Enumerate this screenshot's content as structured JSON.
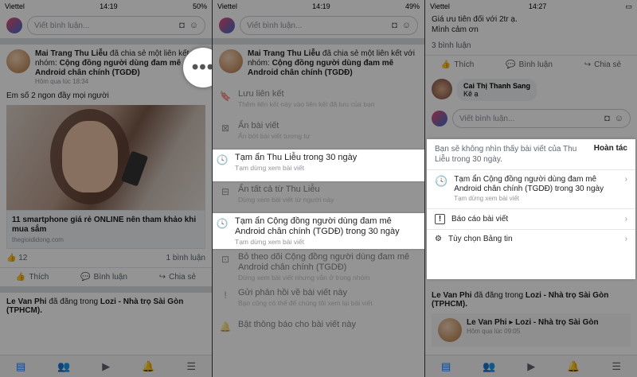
{
  "status": {
    "carrier": "Viettel",
    "time1": "14:19",
    "time2": "14:19",
    "time3": "14:27",
    "battery": "50%",
    "battery2": "49%"
  },
  "composer": {
    "placeholder": "Viết bình luận..."
  },
  "post": {
    "author": "Mai Trang Thu Liễu",
    "action": "đã chia sẻ một liên kết với nhóm:",
    "group": "Cộng đồng người dùng đam mê Android chân chính (TGDĐ)",
    "time": "Hôm qua lúc 18:34",
    "text": "Em số 2 ngon đầy mọi người",
    "link_title": "11 smartphone giá rẻ ONLINE nên tham khảo khi mua sắm",
    "link_domain": "thegioididong.com",
    "reactions_count": "12",
    "comments_count": "1 bình luận",
    "like": "Thích",
    "comment": "Bình luận",
    "share": "Chia sẻ"
  },
  "next_post": {
    "author": "Le Van Phi",
    "action": "đã đăng trong",
    "group": "Lozi - Nhà trọ Sài Gòn (TPHCM)."
  },
  "menu": [
    {
      "label": "Lưu liên kết",
      "desc": "Thêm liên kết này vào liên kết đã lưu của bạn",
      "icon": "bookmark-icon"
    },
    {
      "label": "Ẩn bài viết",
      "desc": "Ẩn bớt bài viết tương tự",
      "icon": "hide-icon"
    },
    {
      "label": "Tạm ẩn Thu Liễu trong 30 ngày",
      "desc": "Tạm dừng xem bài viết",
      "icon": "clock-icon"
    },
    {
      "label": "Ẩn tất cả từ Thu Liễu",
      "desc": "Dừng xem bài viết từ người này",
      "icon": "hide-all-icon"
    },
    {
      "label": "Tạm ẩn Cộng đồng người dùng đam mê Android chân chính (TGDĐ) trong 30 ngày",
      "desc": "Tạm dừng xem bài viết",
      "icon": "clock-icon"
    },
    {
      "label": "Bỏ theo dõi Cộng đồng người dùng đam mê Android chân chính (TGDĐ)",
      "desc": "Dừng xem bài viết nhưng vẫn ở trong nhóm",
      "icon": "unfollow-icon"
    },
    {
      "label": "Gửi phản hồi về bài viết này",
      "desc": "Bạn cũng có thể để chúng tôi xem lại bài viết",
      "icon": "feedback-icon"
    },
    {
      "label": "Bật thông báo cho bài viết này",
      "desc": "",
      "icon": "bell-icon"
    }
  ],
  "panel3": {
    "top_text1": "Giá ưu tiên đối với 2tr ạ.",
    "top_text2": "Mình cảm ơn",
    "comments_count": "3 bình luận",
    "commenter": "Cai Thị Thanh Sang",
    "comment_text": "Kê ạ",
    "card": {
      "notice": "Bạn sẽ không nhìn thấy bài viết của Thu Liễu trong 30 ngày.",
      "undo": "Hoàn tác",
      "snooze_label": "Tạm ẩn Cộng đồng người dùng đam mê Android chân chính (TGDĐ) trong 30 ngày",
      "snooze_desc": "Tạm dừng xem bài viết",
      "report": "Báo cáo bài viết",
      "prefs": "Tùy chọn Bảng tin"
    },
    "next_post_time": "Hôm qua lúc 09:05",
    "next_post_author": "Le Van Phi",
    "next_post_group": "Lozi - Nhà trọ Sài Gòn"
  }
}
